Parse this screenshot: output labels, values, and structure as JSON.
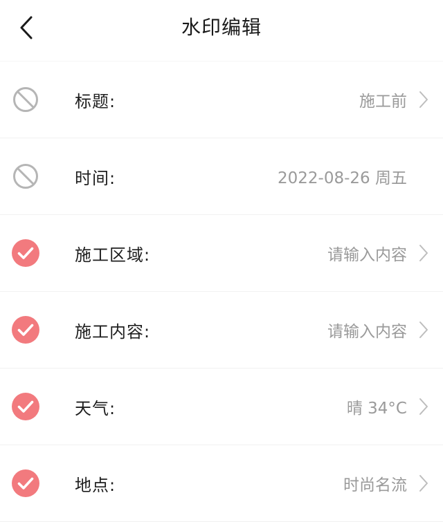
{
  "header": {
    "title": "水印编辑"
  },
  "rows": [
    {
      "label": "标题:",
      "value": "施工前",
      "enabled": false,
      "chevron": true
    },
    {
      "label": "时间:",
      "value": "2022-08-26 周五",
      "enabled": false,
      "chevron": false
    },
    {
      "label": "施工区域:",
      "value": "请输入内容",
      "enabled": true,
      "chevron": true
    },
    {
      "label": "施工内容:",
      "value": "请输入内容",
      "enabled": true,
      "chevron": true
    },
    {
      "label": "天气:",
      "value": "晴 34°C",
      "enabled": true,
      "chevron": true
    },
    {
      "label": "地点:",
      "value": "时尚名流",
      "enabled": true,
      "chevron": true
    }
  ],
  "icons": {
    "back": "chevron-left-icon",
    "disabled": "prohibited-icon",
    "enabled": "check-circle-icon",
    "row_arrow": "chevron-right-icon"
  },
  "colors": {
    "accent": "#F27A7E",
    "disabled_icon": "#B5B5B5",
    "value_text": "#9A9A9A",
    "chevron": "#BDBDBD"
  }
}
